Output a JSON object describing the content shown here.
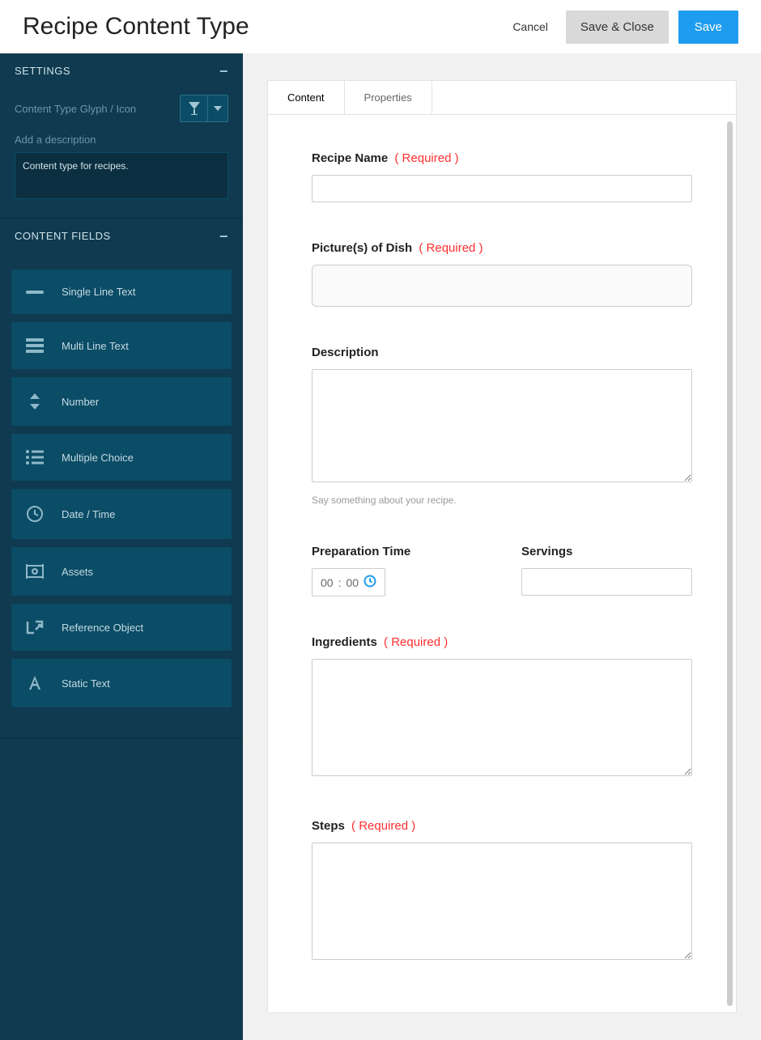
{
  "header": {
    "title": "Recipe Content Type",
    "cancel_label": "Cancel",
    "save_close_label": "Save & Close",
    "save_label": "Save"
  },
  "sidebar": {
    "settings_header": "SETTINGS",
    "glyph_label": "Content Type Glyph / Icon",
    "desc_label": "Add a description",
    "desc_value": "Content type for recipes.",
    "content_fields_header": "CONTENT FIELDS",
    "field_types": [
      {
        "label": "Single Line Text"
      },
      {
        "label": "Multi Line Text"
      },
      {
        "label": "Number"
      },
      {
        "label": "Multiple Choice"
      },
      {
        "label": "Date / Time"
      },
      {
        "label": "Assets"
      },
      {
        "label": "Reference Object"
      },
      {
        "label": "Static Text"
      }
    ]
  },
  "main": {
    "tabs": [
      {
        "label": "Content"
      },
      {
        "label": "Properties"
      }
    ],
    "required_tag": "( Required )",
    "fields": {
      "recipe_name": {
        "label": "Recipe Name"
      },
      "pictures": {
        "label": "Picture(s) of Dish"
      },
      "description": {
        "label": "Description",
        "hint": "Say something about your recipe."
      },
      "prep_time": {
        "label": "Preparation Time",
        "placeholder_hh": "00",
        "placeholder_mm": "00",
        "sep": ":"
      },
      "servings": {
        "label": "Servings"
      },
      "ingredients": {
        "label": "Ingredients"
      },
      "steps": {
        "label": "Steps"
      }
    }
  }
}
